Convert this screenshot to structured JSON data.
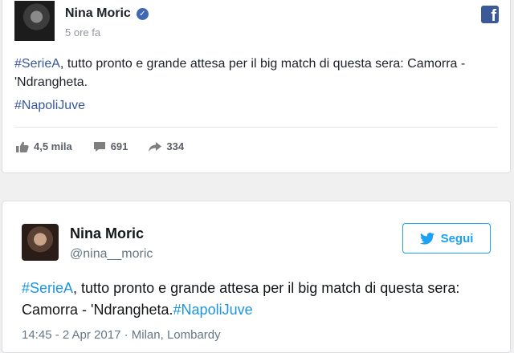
{
  "facebook_post": {
    "author": "Nina Moric",
    "time": "5 ore fa",
    "hashtag": "#SerieA",
    "text": ", tutto pronto e grande attesa per il big match di questa sera: Camorra - 'Ndrangheta.",
    "hashtag2": "#NapoliJuve",
    "likes": "4,5 mila",
    "comments": "691",
    "shares": "334",
    "icons": {
      "verified": "verified-badge-icon",
      "logo": "facebook-logo-icon",
      "like": "thumbs-up-icon",
      "comment": "comment-bubble-icon",
      "share": "share-arrow-icon"
    }
  },
  "twitter_post": {
    "author": "Nina Moric",
    "handle": "@nina__moric",
    "follow_label": "Segui",
    "hashtag": "#SerieA",
    "text": ", tutto pronto e grande attesa per il big match di questa sera: Camorra - 'Ndrangheta.",
    "hashtag2": "#NapoliJuve",
    "meta": "14:45 - 2 Apr 2017 · Milan, Lombardy",
    "icons": {
      "follow": "twitter-bird-icon"
    }
  },
  "colors": {
    "facebook_blue": "#3b5998",
    "fb_link": "#365899",
    "twitter_blue": "#1da1f2"
  }
}
